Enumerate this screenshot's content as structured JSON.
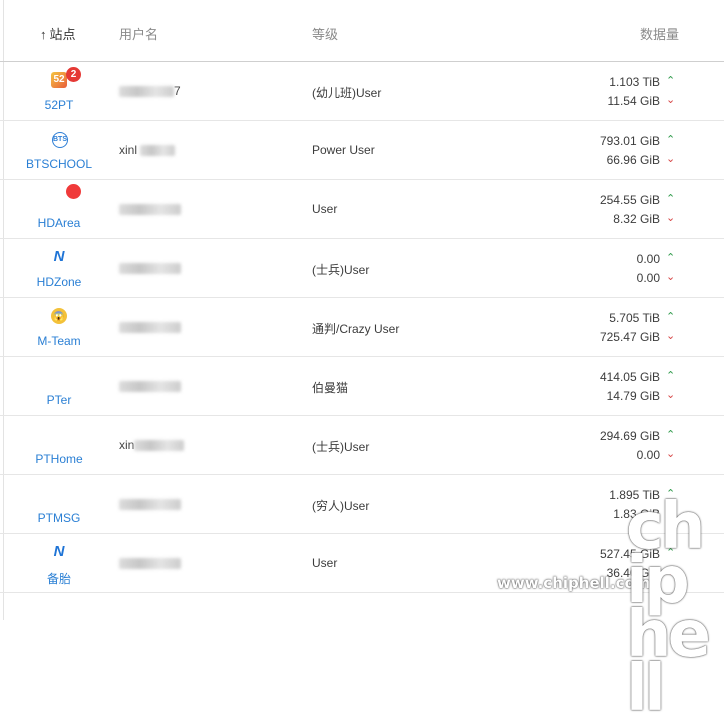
{
  "header": {
    "site_label": "站点",
    "sort_arrow": "↑",
    "user_label": "用户名",
    "level_label": "等级",
    "data_label": "数据量"
  },
  "rows": [
    {
      "site": "52PT",
      "icon": "52pt-icon",
      "badge": "2",
      "user_tail": "7",
      "level": "(幼儿班)User",
      "up": "1.103 TiB",
      "down": "11.54 GiB"
    },
    {
      "site": "BTSCHOOL",
      "icon": "btschool-icon",
      "user_tail": "xinl",
      "level": "Power User",
      "up": "793.01 GiB",
      "down": "66.96 GiB"
    },
    {
      "site": "HDArea",
      "icon": "hdarea-icon",
      "user_tail": "",
      "level": "User",
      "up": "254.55 GiB",
      "down": "8.32 GiB"
    },
    {
      "site": "HDZone",
      "icon": "hdzone-icon",
      "user_tail": "",
      "level": "(士兵)User",
      "up": "0.00",
      "down": "0.00"
    },
    {
      "site": "M-Team",
      "icon": "mteam-icon",
      "user_tail": "",
      "level": "通判/Crazy User",
      "up": "5.705 TiB",
      "down": "725.47 GiB"
    },
    {
      "site": "PTer",
      "icon": "pter-icon",
      "user_tail": "",
      "level": "伯曼猫",
      "up": "414.05 GiB",
      "down": "14.79 GiB"
    },
    {
      "site": "PTHome",
      "icon": "pthome-icon",
      "user_tail": "xin",
      "level": "(士兵)User",
      "up": "294.69 GiB",
      "down": "0.00"
    },
    {
      "site": "PTMSG",
      "icon": "ptmsg-icon",
      "user_tail": "",
      "level": "(穷人)User",
      "up": "1.895 TiB",
      "down": "1.83 GiB"
    },
    {
      "site": "备胎",
      "icon": "beitai-icon",
      "user_tail": "",
      "level": "User",
      "up": "527.45 GiB",
      "down": "36.40 GiB"
    }
  ],
  "arrows": {
    "up": "⌃",
    "down": "⌄"
  },
  "icons": {
    "n_glyph": "N",
    "bt_glyph": "BTS",
    "mteam_glyph": "😱",
    "pt_glyph": "✦"
  },
  "watermark": {
    "url": "www.chiphell.com",
    "mark": "chip hell"
  },
  "colors": {
    "link": "#2a7fd4",
    "up": "#2e9a4a",
    "down": "#d64545",
    "badge": "#e53935"
  }
}
